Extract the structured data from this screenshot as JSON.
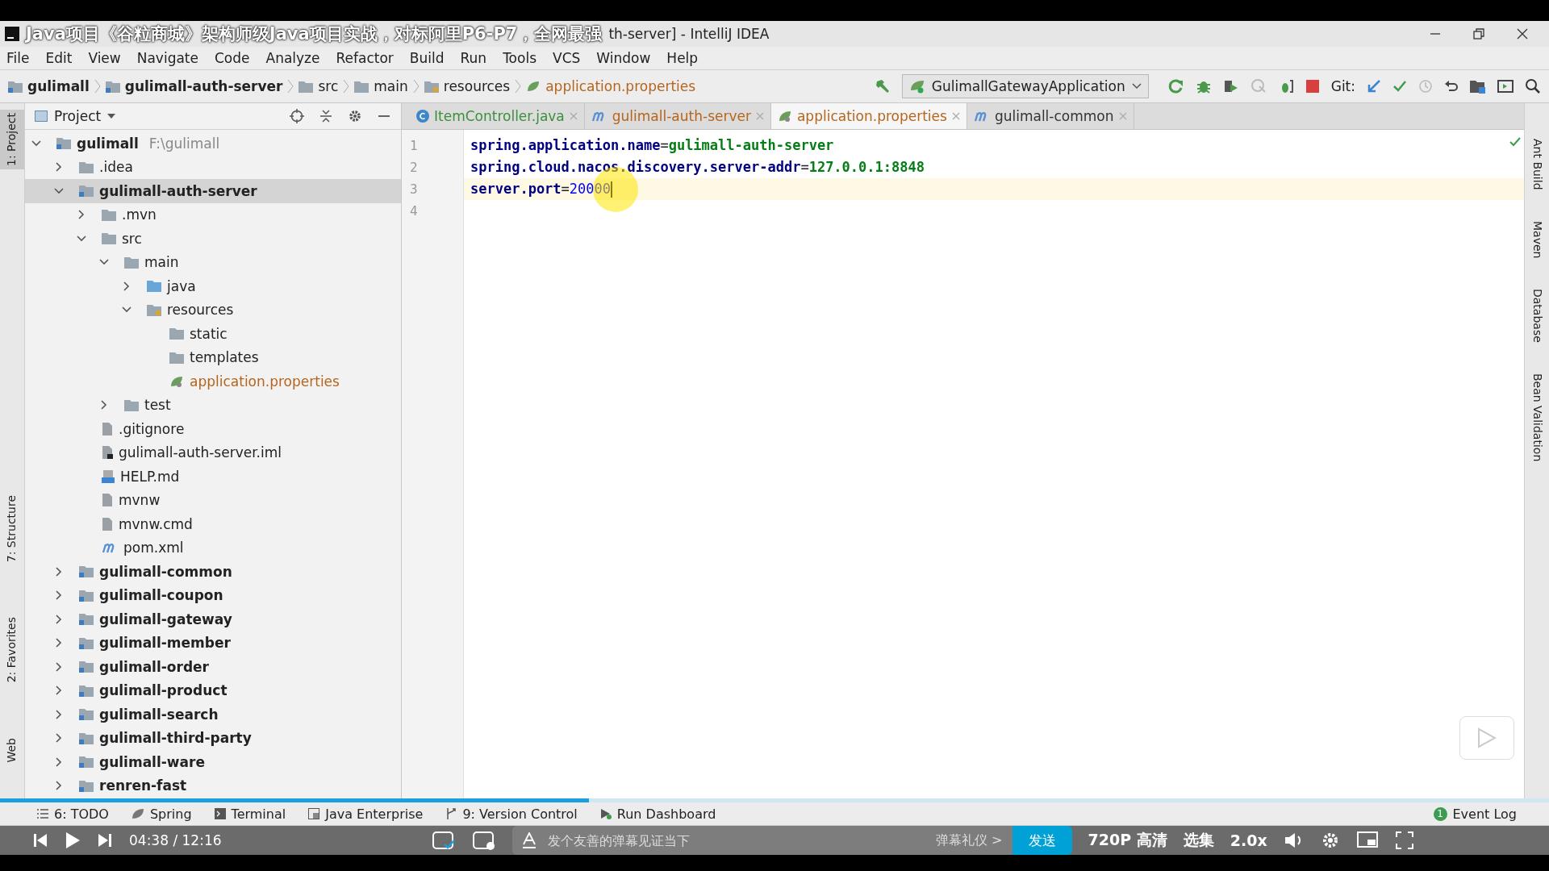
{
  "video_title": "Java项目《谷粒商城》架构师级Java项目实战，对标阿里P6-P7，全网最强",
  "window": {
    "title": "th-server] - IntelliJ IDEA"
  },
  "menu": [
    "File",
    "Edit",
    "View",
    "Navigate",
    "Code",
    "Analyze",
    "Refactor",
    "Build",
    "Run",
    "Tools",
    "VCS",
    "Window",
    "Help"
  ],
  "breadcrumbs": [
    {
      "label": "gulimall",
      "kind": "module"
    },
    {
      "label": "gulimall-auth-server",
      "kind": "module"
    },
    {
      "label": "src",
      "kind": "folder"
    },
    {
      "label": "main",
      "kind": "folder"
    },
    {
      "label": "resources",
      "kind": "resource-folder"
    },
    {
      "label": "application.properties",
      "kind": "properties"
    }
  ],
  "run_config": "GulimallGatewayApplication",
  "git_label": "Git:",
  "project_panel": {
    "title": "Project"
  },
  "tree": [
    {
      "label": "gulimall",
      "path": "F:\\gulimall",
      "kind": "module",
      "expanded": true,
      "selected": false,
      "children": [
        {
          "label": ".idea",
          "kind": "folder",
          "expanded": false,
          "selected": false
        },
        {
          "label": "gulimall-auth-server",
          "kind": "module",
          "expanded": true,
          "selected": true,
          "children": [
            {
              "label": ".mvn",
              "kind": "folder",
              "expanded": false,
              "selected": false
            },
            {
              "label": "src",
              "kind": "folder",
              "expanded": true,
              "selected": false,
              "children": [
                {
                  "label": "main",
                  "kind": "folder",
                  "expanded": true,
                  "selected": false,
                  "children": [
                    {
                      "label": "java",
                      "kind": "source-folder",
                      "expanded": false,
                      "selected": false
                    },
                    {
                      "label": "resources",
                      "kind": "resource-folder",
                      "expanded": true,
                      "selected": false,
                      "children": [
                        {
                          "label": "static",
                          "kind": "folder",
                          "selected": false
                        },
                        {
                          "label": "templates",
                          "kind": "folder",
                          "selected": false
                        },
                        {
                          "label": "application.properties",
                          "kind": "properties",
                          "selected": false
                        }
                      ]
                    }
                  ]
                },
                {
                  "label": "test",
                  "kind": "folder",
                  "expanded": false,
                  "selected": false
                }
              ]
            },
            {
              "label": ".gitignore",
              "kind": "file",
              "selected": false
            },
            {
              "label": "gulimall-auth-server.iml",
              "kind": "iml",
              "selected": false
            },
            {
              "label": "HELP.md",
              "kind": "md",
              "selected": false
            },
            {
              "label": "mvnw",
              "kind": "file",
              "selected": false
            },
            {
              "label": "mvnw.cmd",
              "kind": "file",
              "selected": false
            },
            {
              "label": "pom.xml",
              "kind": "maven",
              "selected": false
            }
          ]
        },
        {
          "label": "gulimall-common",
          "kind": "module",
          "expanded": false,
          "selected": false
        },
        {
          "label": "gulimall-coupon",
          "kind": "module",
          "expanded": false,
          "selected": false
        },
        {
          "label": "gulimall-gateway",
          "kind": "module",
          "expanded": false,
          "selected": false
        },
        {
          "label": "gulimall-member",
          "kind": "module",
          "expanded": false,
          "selected": false
        },
        {
          "label": "gulimall-order",
          "kind": "module",
          "expanded": false,
          "selected": false
        },
        {
          "label": "gulimall-product",
          "kind": "module",
          "expanded": false,
          "selected": false
        },
        {
          "label": "gulimall-search",
          "kind": "module",
          "expanded": false,
          "selected": false
        },
        {
          "label": "gulimall-third-party",
          "kind": "module",
          "expanded": false,
          "selected": false
        },
        {
          "label": "gulimall-ware",
          "kind": "module",
          "expanded": false,
          "selected": false
        },
        {
          "label": "renren-fast",
          "kind": "module",
          "expanded": false,
          "selected": false
        }
      ]
    }
  ],
  "tabs": [
    {
      "label": "ItemController.java",
      "kind": "class",
      "color": "#3d8f3d",
      "selected": false
    },
    {
      "label": "gulimall-auth-server",
      "kind": "maven",
      "color": "#b5651d",
      "selected": false
    },
    {
      "label": "application.properties",
      "kind": "properties",
      "color": "#b5651d",
      "selected": true
    },
    {
      "label": "gulimall-common",
      "kind": "maven",
      "color": "#333333",
      "selected": false
    }
  ],
  "code": [
    {
      "number": "1",
      "key": "spring.application.name",
      "sep": "=",
      "value": "gulimall-auth-server",
      "kind": "string",
      "current": false
    },
    {
      "number": "2",
      "key": "spring.cloud.nacos.discovery.server-addr",
      "sep": "=",
      "value": "127.0.0.1:8848",
      "kind": "string",
      "current": false
    },
    {
      "number": "3",
      "key": "server.port",
      "sep": "=",
      "value": "20000",
      "kind": "number",
      "current": true
    },
    {
      "number": "4",
      "current": false
    }
  ],
  "left_strip": [
    "1: Project",
    "7: Structure",
    "2: Favorites",
    "Web"
  ],
  "right_strip": [
    "Ant Build",
    "Maven",
    "Database",
    "Bean Validation"
  ],
  "tool_windows": [
    {
      "label": "6: TODO",
      "kind": "list"
    },
    {
      "label": "Spring",
      "kind": "leaf"
    },
    {
      "label": "Terminal",
      "kind": "terminal"
    },
    {
      "label": "Java Enterprise",
      "kind": "enterprise"
    },
    {
      "label": "9: Version Control",
      "kind": "vcs"
    },
    {
      "label": "Run Dashboard",
      "kind": "run"
    }
  ],
  "event_log": {
    "label": "Event Log",
    "count": "1"
  },
  "player": {
    "progress": {
      "level": 0.38
    },
    "time": "04:38 / 12:16",
    "danmaku_placeholder": "发个友善的弹幕见证当下",
    "etiquette": "弹幕礼仪 >",
    "send": "发送",
    "quality": "720P 高清",
    "episodes": "选集",
    "speed": "2.0x"
  }
}
